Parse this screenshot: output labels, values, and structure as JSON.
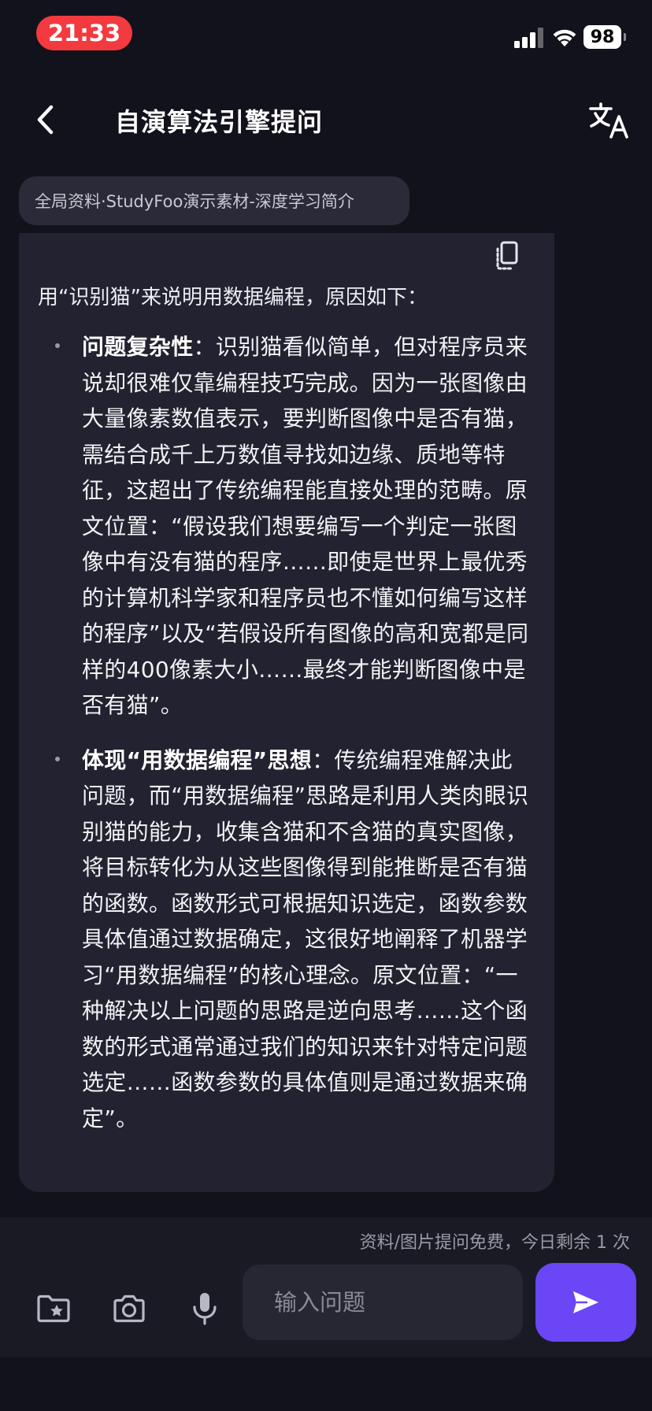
{
  "status_bar": {
    "time": "21:33",
    "battery": "98"
  },
  "header": {
    "title": "自演算法引擎提问"
  },
  "source_chip": {
    "label": "全局资料·StudyFoo演示素材-深度学习简介"
  },
  "answer": {
    "intro": "用“识别猫”来说明用数据编程，原因如下：",
    "bullets": [
      {
        "title": "问题复杂性",
        "text": "：识别猫看似简单，但对程序员来说却很难仅靠编程技巧完成。因为一张图像由大量像素数值表示，要判断图像中是否有猫，需结合成千上万数值寻找如边缘、质地等特征，这超出了传统编程能直接处理的范畴。原文位置：“假设我们想要编写一个判定一张图像中有没有猫的程序……即使是世界上最优秀的计算机科学家和程序员也不懂如何编写这样的程序”以及“若假设所有图像的高和宽都是同样的400像素大小……最终才能判断图像中是否有猫”。"
      },
      {
        "title": "体现“用数据编程”思想",
        "text": "：传统编程难解决此问题，而“用数据编程”思路是利用人类肉眼识别猫的能力，收集含猫和不含猫的真实图像，将目标转化为从这些图像得到能推断是否有猫的函数。函数形式可根据知识选定，函数参数具体值通过数据确定，这很好地阐释了机器学习“用数据编程”的核心理念。原文位置：“一种解决以上问题的思路是逆向思考……这个函数的形式通常通过我们的知识来针对特定问题选定……函数参数的具体值则是通过数据来确定”。"
      }
    ]
  },
  "bottom_bar": {
    "quota_note": "资料/图片提问免费，今日剩余 1 次",
    "input_placeholder": "输入问题"
  },
  "icons": {
    "back": "chevron-left-icon",
    "translate": "translate-icon",
    "copy": "copy-icon",
    "folder": "folder-star-icon",
    "camera": "camera-icon",
    "mic": "microphone-icon",
    "send": "send-icon"
  },
  "colors": {
    "background": "#12121c",
    "card": "#222230",
    "accent": "#6a46f6",
    "time_pill": "#f23a3f"
  }
}
